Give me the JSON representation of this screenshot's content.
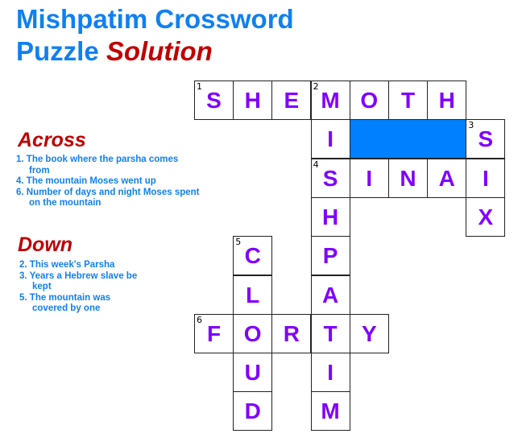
{
  "title": {
    "line1": "Mishpatim Crossword",
    "line2_main": "Puzzle",
    "line2_emphasis": "Solution"
  },
  "across": {
    "heading": "Across",
    "clues": [
      {
        "number": "1.",
        "text": "The book where the parsha comes from"
      },
      {
        "number": "4.",
        "text": "The mountain Moses went up"
      },
      {
        "number": "6.",
        "text": "Number of days and night Moses spent on the mountain"
      }
    ]
  },
  "down": {
    "heading": "Down",
    "clues": [
      {
        "number": "2.",
        "text": "This week's Parsha"
      },
      {
        "number": "3.",
        "text": "Years a Hebrew slave be kept"
      },
      {
        "number": "5.",
        "text": "The mountain was covered by one"
      }
    ]
  },
  "colors": {
    "title_blue": "#1080F0",
    "accent_red": "#C00000",
    "letter_purple": "#8000FF",
    "shaded_block": "#0080FF"
  },
  "answers": {
    "across": [
      {
        "number": "1",
        "word": "SHEMOTH"
      },
      {
        "number": "4",
        "word": "SINAI"
      },
      {
        "number": "6",
        "word": "FORTY"
      }
    ],
    "down": [
      {
        "number": "2",
        "word": "MISHPATIM"
      },
      {
        "number": "3",
        "word": "SIX"
      },
      {
        "number": "5",
        "word": "CLOUD"
      }
    ]
  },
  "cells": [
    {
      "row": 0,
      "col": 0,
      "letter": "S",
      "number": "1"
    },
    {
      "row": 0,
      "col": 1,
      "letter": "H"
    },
    {
      "row": 0,
      "col": 2,
      "letter": "E"
    },
    {
      "row": 0,
      "col": 3,
      "letter": "M",
      "number": "2"
    },
    {
      "row": 0,
      "col": 4,
      "letter": "O"
    },
    {
      "row": 0,
      "col": 5,
      "letter": "T"
    },
    {
      "row": 0,
      "col": 6,
      "letter": "H"
    },
    {
      "row": 1,
      "col": 3,
      "letter": "I"
    },
    {
      "row": 1,
      "col": 7,
      "letter": "S",
      "number": "3"
    },
    {
      "row": 2,
      "col": 3,
      "letter": "S",
      "number": "4"
    },
    {
      "row": 2,
      "col": 4,
      "letter": "I"
    },
    {
      "row": 2,
      "col": 5,
      "letter": "N"
    },
    {
      "row": 2,
      "col": 6,
      "letter": "A"
    },
    {
      "row": 2,
      "col": 7,
      "letter": "I"
    },
    {
      "row": 3,
      "col": 3,
      "letter": "H"
    },
    {
      "row": 3,
      "col": 7,
      "letter": "X"
    },
    {
      "row": 4,
      "col": 1,
      "letter": "C",
      "number": "5"
    },
    {
      "row": 4,
      "col": 3,
      "letter": "P"
    },
    {
      "row": 5,
      "col": 1,
      "letter": "L"
    },
    {
      "row": 5,
      "col": 3,
      "letter": "A"
    },
    {
      "row": 6,
      "col": 0,
      "letter": "F",
      "number": "6"
    },
    {
      "row": 6,
      "col": 1,
      "letter": "O"
    },
    {
      "row": 6,
      "col": 2,
      "letter": "R"
    },
    {
      "row": 6,
      "col": 3,
      "letter": "T"
    },
    {
      "row": 6,
      "col": 4,
      "letter": "Y"
    },
    {
      "row": 7,
      "col": 1,
      "letter": "U"
    },
    {
      "row": 7,
      "col": 3,
      "letter": "I"
    },
    {
      "row": 8,
      "col": 1,
      "letter": "D"
    },
    {
      "row": 8,
      "col": 3,
      "letter": "M"
    }
  ],
  "shaded_blocks": [
    {
      "row": 1,
      "col_start": 4,
      "col_end": 6
    }
  ]
}
